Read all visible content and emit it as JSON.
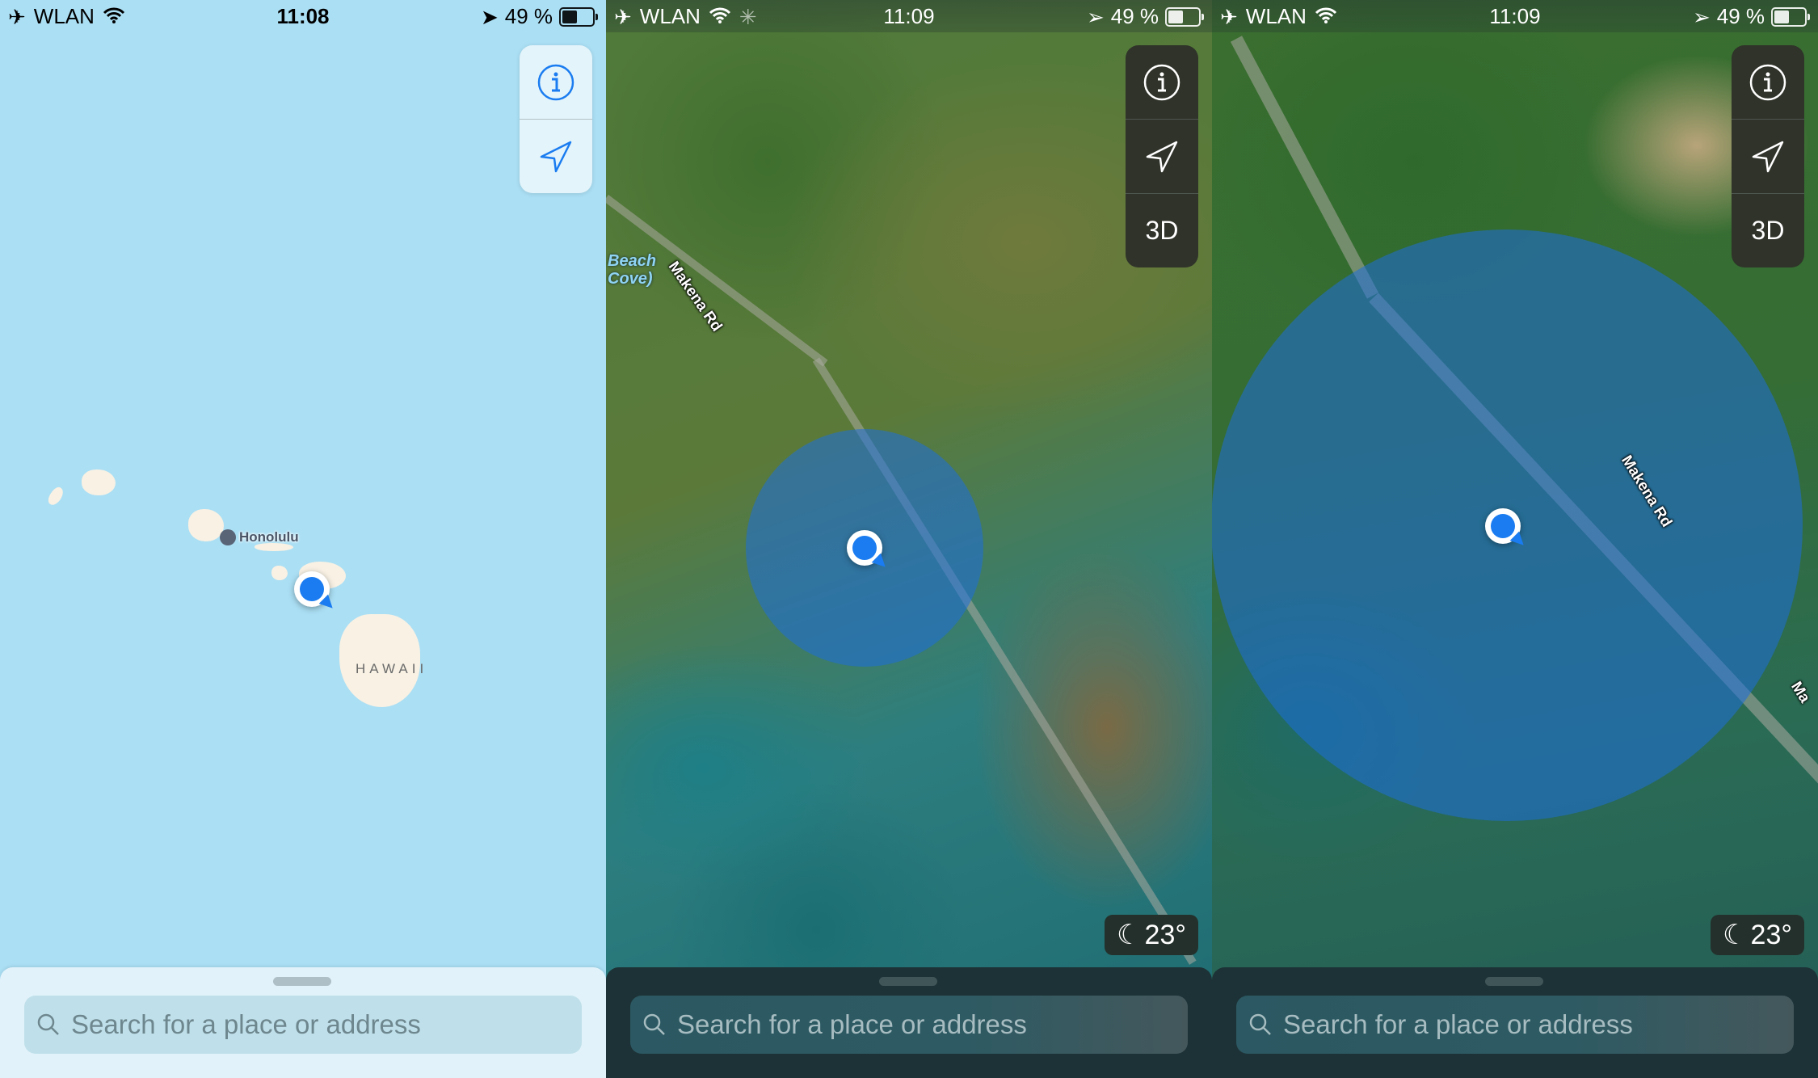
{
  "panels": [
    {
      "status": {
        "carrier": "WLAN",
        "time": "11:08",
        "battery": "49 %",
        "icons": [
          "airplane-icon",
          "wifi-icon",
          "location-arrow-icon",
          "battery-icon"
        ]
      },
      "controls": {
        "info_label": "i",
        "buttons": [
          "info-button",
          "track-location-button"
        ]
      },
      "map": {
        "style": "standard",
        "labels": {
          "city": "Honolulu",
          "island": "HAWAII"
        }
      },
      "search": {
        "placeholder": "Search for a place or address"
      }
    },
    {
      "status": {
        "carrier": "WLAN",
        "time": "11:09",
        "battery": "49 %",
        "icons": [
          "airplane-icon",
          "wifi-icon",
          "activity-spinner-icon",
          "location-arrow-icon",
          "battery-icon"
        ]
      },
      "controls": {
        "info_label": "i",
        "three_d_label": "3D"
      },
      "map": {
        "style": "satellite",
        "labels": {
          "road": "Makena Rd",
          "poi_line1": "Beach",
          "poi_line2": "Cove)"
        }
      },
      "weather": {
        "icon": "moon-stars-icon",
        "temperature": "23°"
      },
      "search": {
        "placeholder": "Search for a place or address"
      }
    },
    {
      "status": {
        "carrier": "WLAN",
        "time": "11:09",
        "battery": "49 %",
        "icons": [
          "airplane-icon",
          "wifi-icon",
          "location-arrow-icon",
          "battery-icon"
        ]
      },
      "controls": {
        "info_label": "i",
        "three_d_label": "3D"
      },
      "map": {
        "style": "satellite",
        "labels": {
          "road": "Makena Rd",
          "road_partial": "Ma"
        }
      },
      "weather": {
        "icon": "moon-stars-icon",
        "temperature": "23°"
      },
      "search": {
        "placeholder": "Search for a place or address"
      }
    }
  ],
  "colors": {
    "accent": "#1a7cf0",
    "water": "#abdff4",
    "land": "#f8f1e4",
    "dark_control": "#2f3329"
  }
}
